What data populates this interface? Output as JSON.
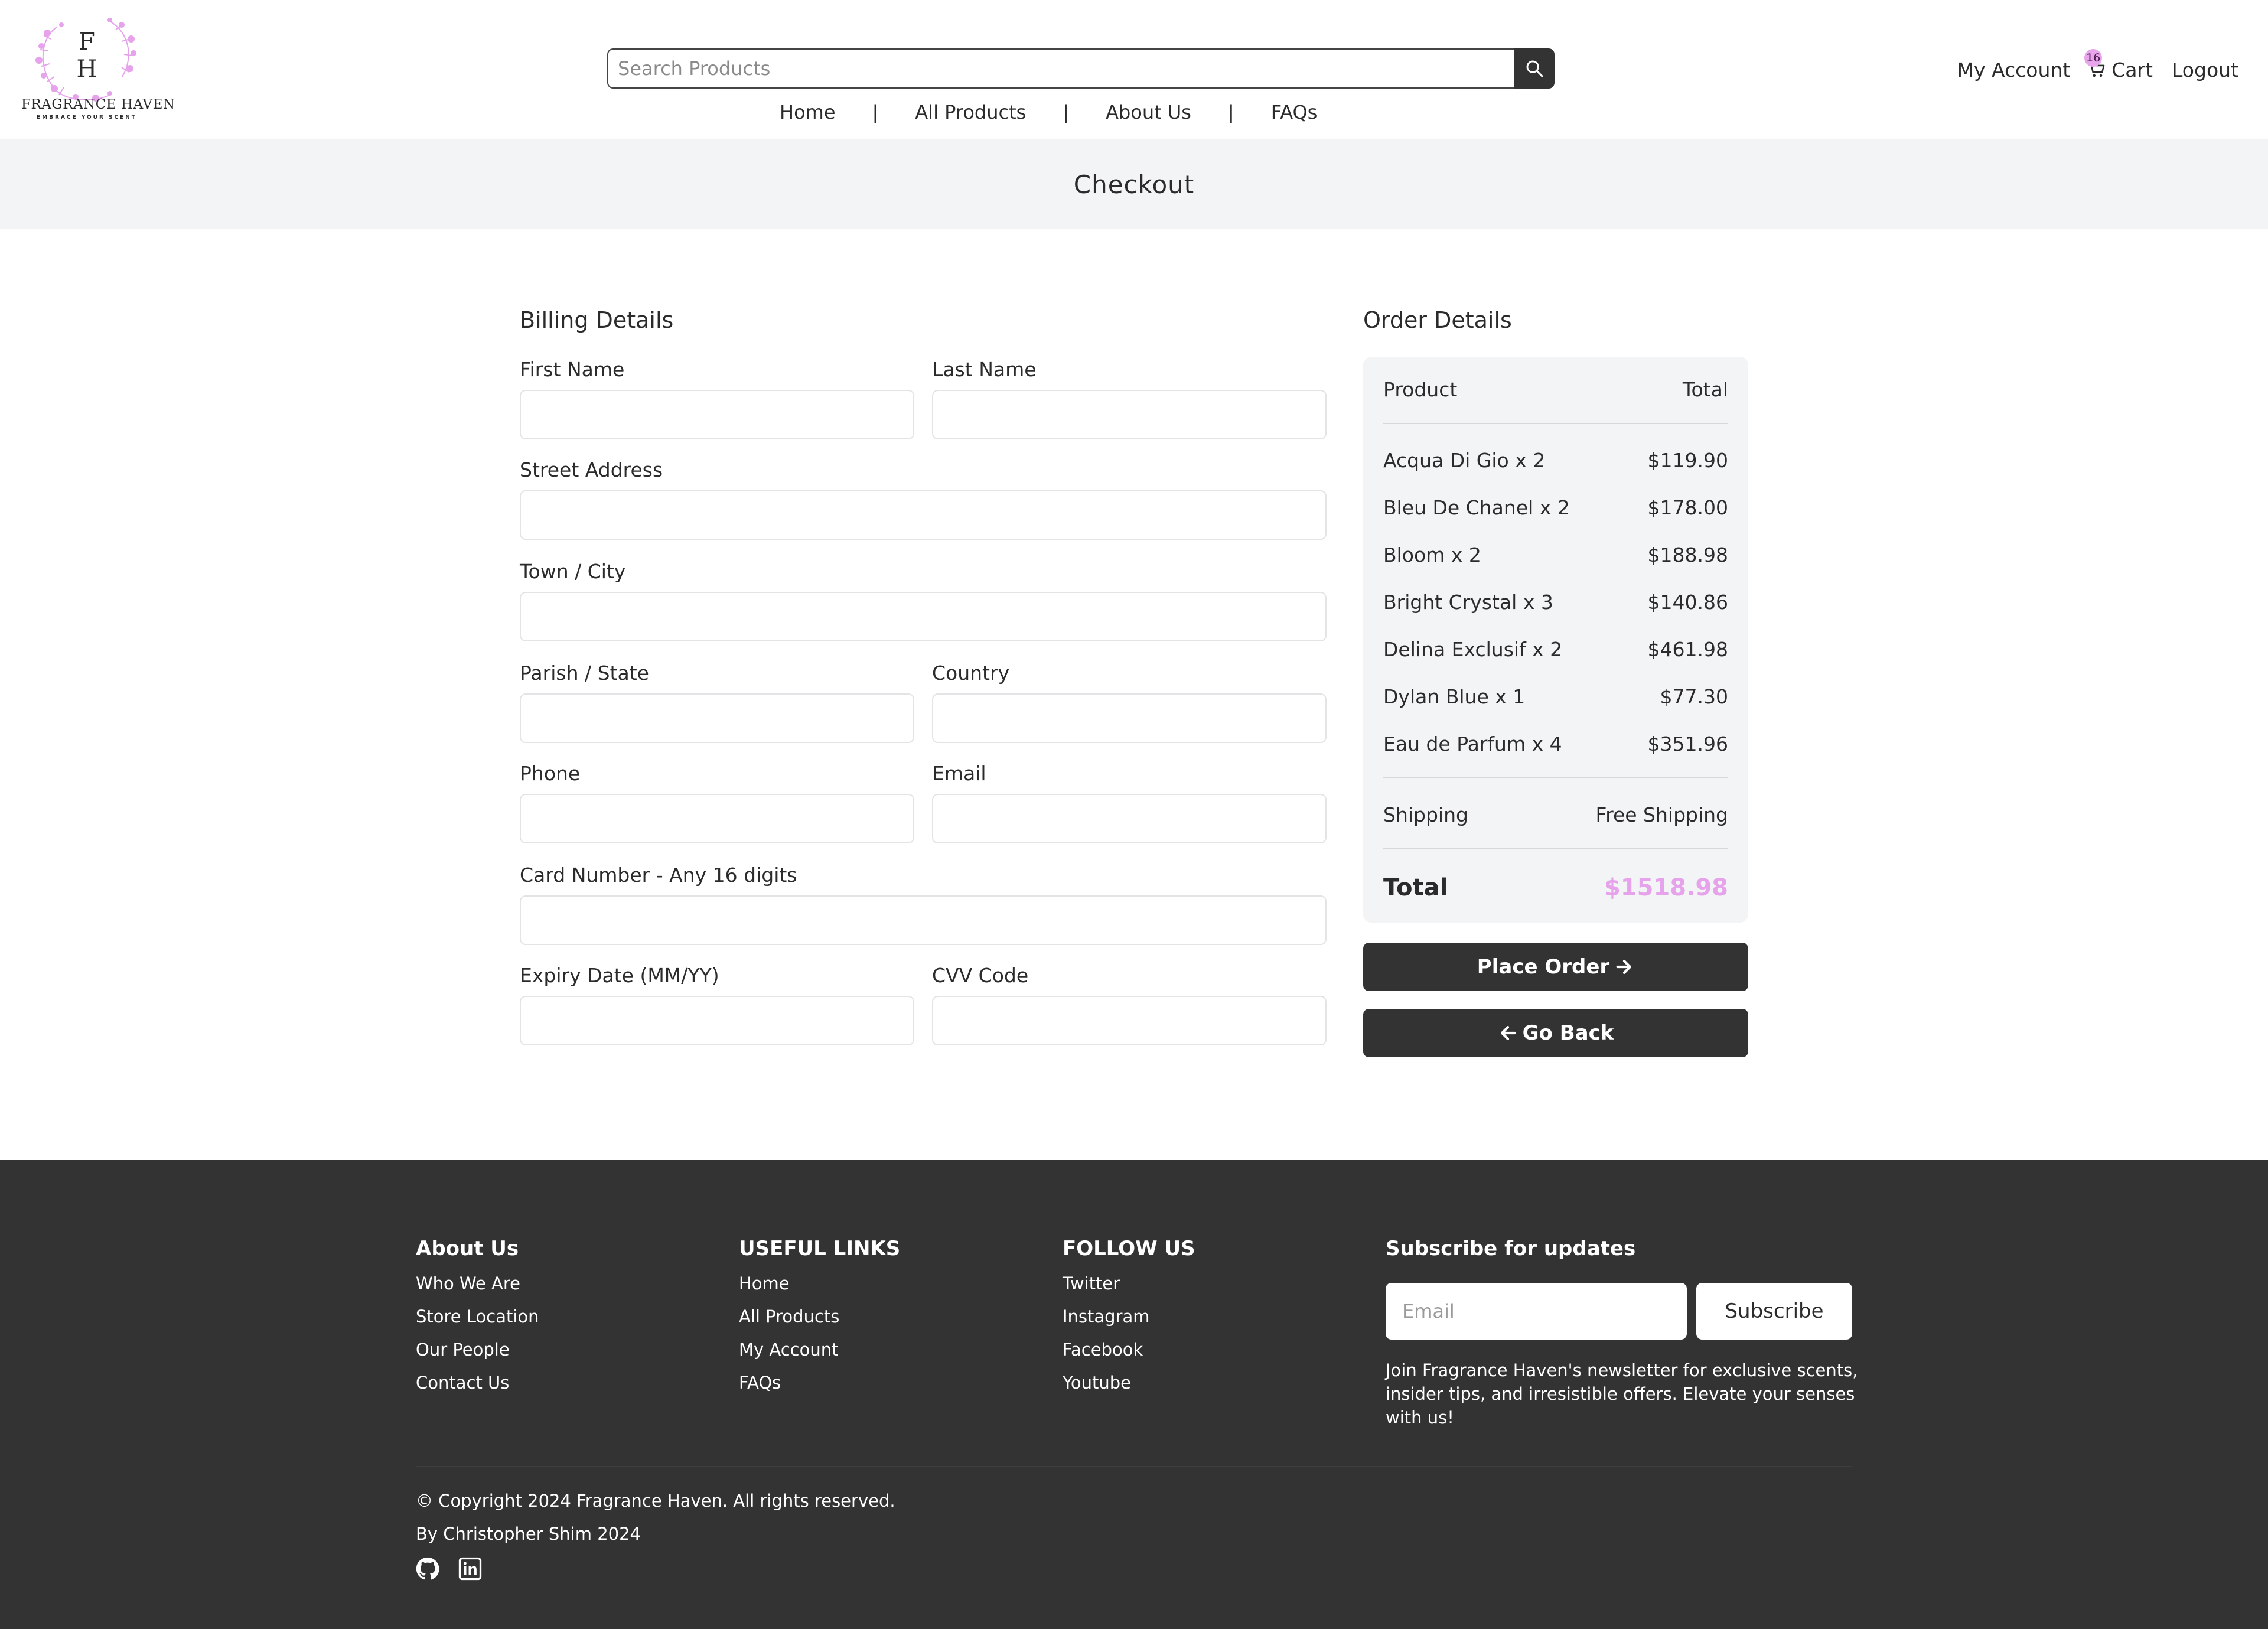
{
  "brand": {
    "initials_top": "F",
    "initials_bottom": "H",
    "name": "FRAGRANCE HAVEN",
    "tagline": "EMBRACE YOUR SCENT",
    "accent_color": "#e6a3ec"
  },
  "search": {
    "placeholder": "Search Products",
    "icon": "search-icon"
  },
  "nav": {
    "items": [
      "Home",
      "All Products",
      "About Us",
      "FAQs"
    ],
    "separator": "|"
  },
  "account": {
    "my_account": "My Account",
    "cart_label": "Cart",
    "cart_count": "16",
    "logout": "Logout"
  },
  "page": {
    "title": "Checkout"
  },
  "billing": {
    "title": "Billing Details",
    "first_name": "First Name",
    "last_name": "Last Name",
    "street": "Street Address",
    "town": "Town / City",
    "parish": "Parish / State",
    "country": "Country",
    "phone": "Phone",
    "email": "Email",
    "card": "Card Number - Any 16 digits",
    "expiry": "Expiry Date (MM/YY)",
    "cvv": "CVV Code"
  },
  "order": {
    "title": "Order Details",
    "col_product": "Product",
    "col_total": "Total",
    "items": [
      {
        "name": "Acqua Di Gio x 2",
        "price": "$119.90"
      },
      {
        "name": "Bleu De Chanel x 2",
        "price": "$178.00"
      },
      {
        "name": "Bloom x 2",
        "price": "$188.98"
      },
      {
        "name": "Bright Crystal x 3",
        "price": "$140.86"
      },
      {
        "name": "Delina Exclusif x 2",
        "price": "$461.98"
      },
      {
        "name": "Dylan Blue x 1",
        "price": "$77.30"
      },
      {
        "name": "Eau de Parfum x 4",
        "price": "$351.96"
      }
    ],
    "shipping_label": "Shipping",
    "shipping_value": "Free Shipping",
    "total_label": "Total",
    "total_value": "$1518.98",
    "place_order": "Place Order",
    "go_back": "Go Back"
  },
  "footer": {
    "about": {
      "title": "About Us",
      "links": [
        "Who We Are",
        "Store Location",
        "Our People",
        "Contact Us"
      ]
    },
    "useful": {
      "title": "USEFUL LINKS",
      "links": [
        "Home",
        "All Products",
        "My Account",
        "FAQs"
      ]
    },
    "follow": {
      "title": "FOLLOW US",
      "links": [
        "Twitter",
        "Instagram",
        "Facebook",
        "Youtube"
      ]
    },
    "subscribe": {
      "title": "Subscribe for updates",
      "placeholder": "Email",
      "button": "Subscribe",
      "text": "Join Fragrance Haven's newsletter for exclusive scents, insider tips, and irresistible offers. Elevate your senses with us!"
    },
    "copyright": "© Copyright 2024 Fragrance Haven. All rights reserved.",
    "credit": "By Christopher Shim 2024",
    "social_icons": [
      "github-icon",
      "linkedin-icon"
    ]
  }
}
